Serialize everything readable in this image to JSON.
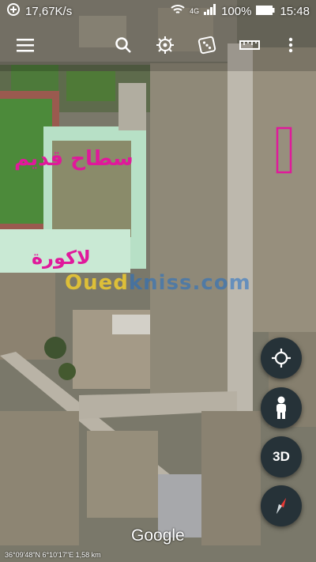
{
  "status_bar": {
    "speed": "17,67K/s",
    "network": "4G",
    "battery": "100%",
    "time": "15:48"
  },
  "toolbar": {
    "icons": [
      "menu-icon",
      "search-icon",
      "voyager-icon",
      "dice-icon",
      "ruler-icon",
      "more-icon"
    ]
  },
  "map_labels": {
    "old_roof": "سطاح قديم",
    "lakora": "لاكورة"
  },
  "watermark": {
    "brand_start": "Oued",
    "brand_rest": "kniss.com"
  },
  "controls": {
    "three_d_label": "3D"
  },
  "footer": {
    "brand": "Google",
    "coordinates": "36°09'48\"N 6°10'17\"E 1,58 km"
  },
  "colors": {
    "annotation_magenta": "#e0199b",
    "fab_background": "#263238",
    "compass_red": "#e53935"
  }
}
